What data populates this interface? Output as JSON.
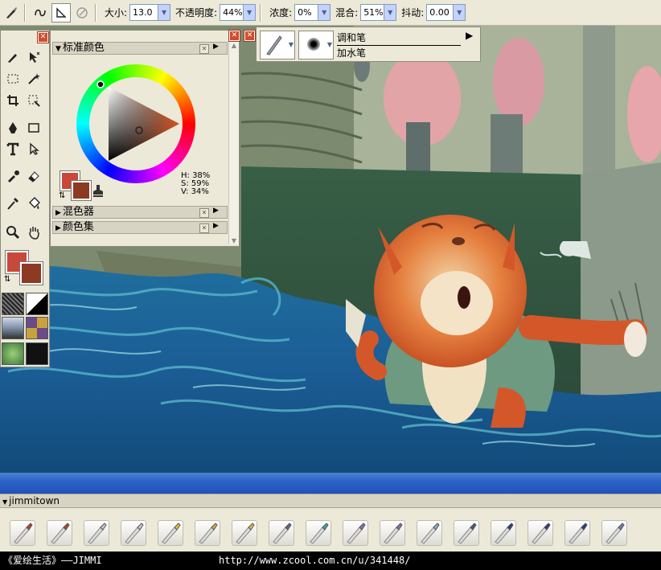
{
  "options_bar": {
    "size_label": "大小:",
    "size_value": "13.0",
    "opacity_label": "不透明度:",
    "opacity_value": "44%",
    "concentration_label": "浓度:",
    "concentration_value": "0%",
    "blend_label": "混合:",
    "blend_value": "51%",
    "jitter_label": "抖动:",
    "jitter_value": "0.00"
  },
  "color_panel": {
    "title": "标准颜色",
    "hsv": {
      "h": "H: 38%",
      "s": "S: 59%",
      "v": "V: 34%"
    },
    "mixer_title": "混色器",
    "color_sets_title": "颜色集",
    "primary_color": "#c8483a",
    "secondary_color": "#8c3a22"
  },
  "brush_selector": {
    "category": "调和笔",
    "variant": "加水笔"
  },
  "bottom_panel": {
    "title": "jimmitown"
  },
  "footer": {
    "left": "《爱绘生活》——JIMMI",
    "url": "http://www.zcool.com.cn/u/341448/"
  },
  "colors": {
    "ui_bg": "#ece9d8",
    "title_bg": "#d8d4c4",
    "blue_bar": "#2c62c5",
    "close_red": "#d34c2a"
  }
}
